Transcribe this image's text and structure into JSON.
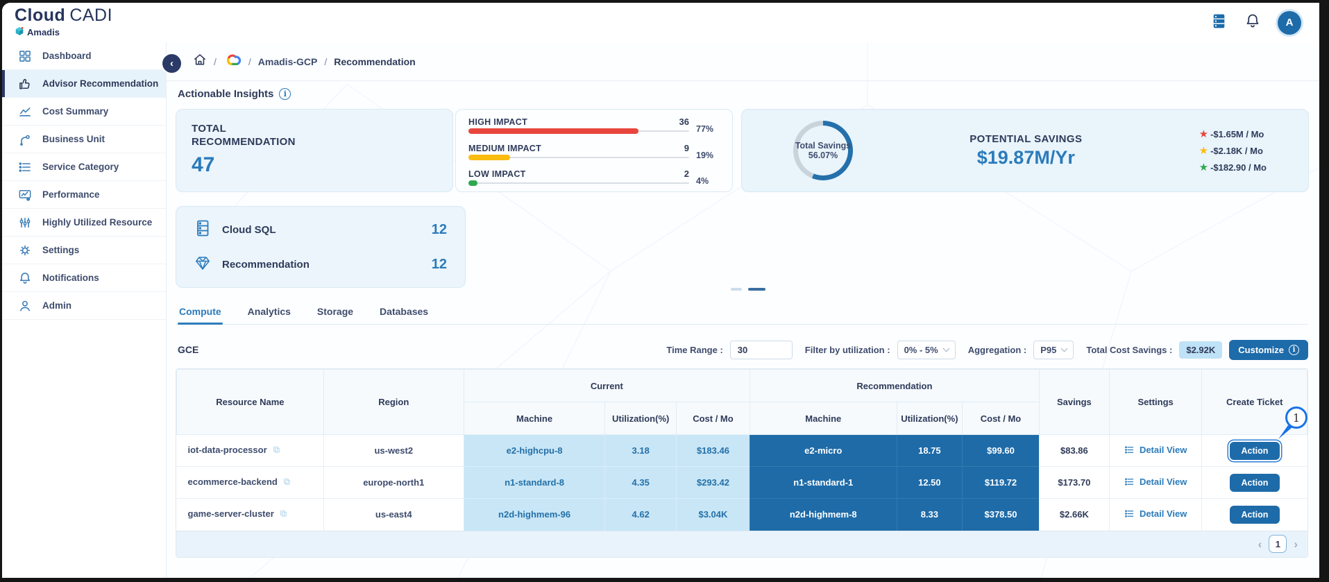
{
  "header": {
    "brand_bold": "Cloud",
    "brand_light": "CADI",
    "company": "Amadis",
    "avatar": "A"
  },
  "sidebar": {
    "items": [
      {
        "label": "Dashboard"
      },
      {
        "label": "Advisor Recommendation"
      },
      {
        "label": "Cost Summary"
      },
      {
        "label": "Business Unit"
      },
      {
        "label": "Service Category"
      },
      {
        "label": "Performance"
      },
      {
        "label": "Highly Utilized Resource"
      },
      {
        "label": "Settings"
      },
      {
        "label": "Notifications"
      },
      {
        "label": "Admin"
      }
    ]
  },
  "breadcrumb": {
    "sep": "/",
    "project": "Amadis-GCP",
    "page": "Recommendation"
  },
  "insights": {
    "title": "Actionable Insights",
    "total_card": {
      "line1": "TOTAL",
      "line2": "RECOMMENDATION",
      "value": "47"
    },
    "impact": {
      "bars": [
        {
          "label": "HIGH IMPACT",
          "count": "36",
          "pct": "77%",
          "width": "77%",
          "color": "#e8463d"
        },
        {
          "label": "MEDIUM IMPACT",
          "count": "9",
          "pct": "19%",
          "width": "19%",
          "color": "#fbbc10"
        },
        {
          "label": "LOW IMPACT",
          "count": "2",
          "pct": "4%",
          "width": "4%",
          "color": "#2fa84f"
        }
      ]
    },
    "savings": {
      "donut_title": "Total Savings",
      "donut_value": "56.07%",
      "percent": 56.07,
      "ring_color": "#2470ab",
      "track_color": "#c9d3db",
      "title": "POTENTIAL SAVINGS",
      "amount": "$19.87M/Yr",
      "stars": [
        {
          "color": "#e8463d",
          "text": "-$1.65M / Mo"
        },
        {
          "color": "#fbbc10",
          "text": "-$2.18K / Mo"
        },
        {
          "color": "#2fa84f",
          "text": "-$182.90 / Mo"
        }
      ]
    }
  },
  "service_card": {
    "rows": [
      {
        "label": "Cloud SQL",
        "value": "12"
      },
      {
        "label": "Recommendation",
        "value": "12"
      }
    ]
  },
  "tabs": {
    "items": [
      "Compute",
      "Analytics",
      "Storage",
      "Databases"
    ]
  },
  "filters": {
    "section": "GCE",
    "time_label": "Time Range :",
    "time_value": "30",
    "util_label": "Filter by utilization :",
    "util_value": "0% - 5%",
    "agg_label": "Aggregation :",
    "agg_value": "P95",
    "tcs_label": "Total Cost Savings :",
    "tcs_value": "$2.92K",
    "customize": "Customize"
  },
  "table": {
    "h": {
      "resource": "Resource Name",
      "region": "Region",
      "current": "Current",
      "recommendation": "Recommendation",
      "machine": "Machine",
      "util": "Utilization(%)",
      "cost": "Cost / Mo",
      "savings": "Savings",
      "settings": "Settings",
      "ticket": "Create Ticket"
    },
    "detail_view": "Detail View",
    "action": "Action",
    "rows": [
      {
        "resource": "iot-data-processor",
        "region": "us-west2",
        "cur_machine": "e2-highcpu-8",
        "cur_util": "3.18",
        "cur_cost": "$183.46",
        "rec_machine": "e2-micro",
        "rec_util": "18.75",
        "rec_cost": "$99.60",
        "savings": "$83.86"
      },
      {
        "resource": "ecommerce-backend",
        "region": "europe-north1",
        "cur_machine": "n1-standard-8",
        "cur_util": "4.35",
        "cur_cost": "$293.42",
        "rec_machine": "n1-standard-1",
        "rec_util": "12.50",
        "rec_cost": "$119.72",
        "savings": "$173.70"
      },
      {
        "resource": "game-server-cluster",
        "region": "us-east4",
        "cur_machine": "n2d-highmem-96",
        "cur_util": "4.62",
        "cur_cost": "$3.04K",
        "rec_machine": "n2d-highmem-8",
        "rec_util": "8.33",
        "rec_cost": "$378.50",
        "savings": "$2.66K"
      }
    ],
    "page": "1"
  },
  "annotation": {
    "label": "1"
  }
}
